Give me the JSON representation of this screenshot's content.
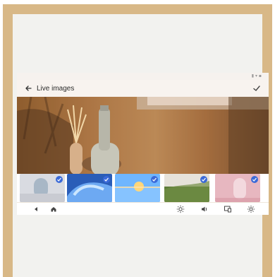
{
  "screen": {
    "title": "Live images",
    "status_text": "▮ ▾ ▪"
  },
  "icons": {
    "back": "back-arrow-icon",
    "confirm": "check-icon",
    "nav_back": "nav-back-icon",
    "nav_home": "home-icon",
    "brightness": "brightness-icon",
    "volume": "volume-icon",
    "screen_mirror": "screen-mirror-icon",
    "settings": "settings-gear-icon"
  },
  "thumbnails": [
    {
      "name": "arch-window",
      "selected": true
    },
    {
      "name": "blue-wave",
      "selected": true
    },
    {
      "name": "sunset-water",
      "selected": true
    },
    {
      "name": "green-landscape",
      "selected": true
    },
    {
      "name": "pink-arch",
      "selected": true
    }
  ],
  "colors": {
    "frame": "#d8b887",
    "accent": "#3b6ad8"
  }
}
